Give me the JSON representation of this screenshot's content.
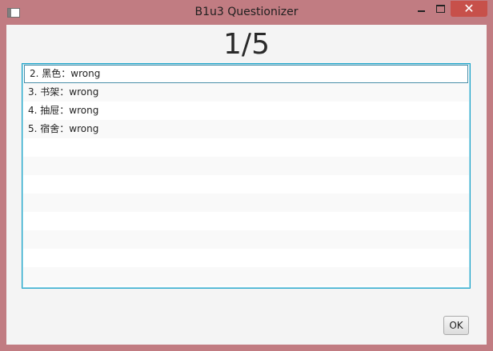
{
  "window": {
    "title": "B1u3 Questionizer",
    "close_glyph": "✕",
    "accent_color": "#1aa3c9",
    "frame_color": "#c17c82"
  },
  "counter": "1/5",
  "list": {
    "items": [
      {
        "label": "2. 黑色：wrong",
        "selected": true
      },
      {
        "label": "3. 书架：wrong",
        "selected": false
      },
      {
        "label": "4. 抽屉：wrong",
        "selected": false
      },
      {
        "label": "5. 宿舍：wrong",
        "selected": false
      },
      {
        "label": "",
        "selected": false
      },
      {
        "label": "",
        "selected": false
      },
      {
        "label": "",
        "selected": false
      },
      {
        "label": "",
        "selected": false
      },
      {
        "label": "",
        "selected": false
      },
      {
        "label": "",
        "selected": false
      },
      {
        "label": "",
        "selected": false
      },
      {
        "label": "",
        "selected": false
      }
    ]
  },
  "ok_button": "OK",
  "icons": {
    "app": "app-window-icon",
    "minimize": "minimize-icon",
    "maximize": "maximize-icon",
    "close": "close-icon"
  }
}
